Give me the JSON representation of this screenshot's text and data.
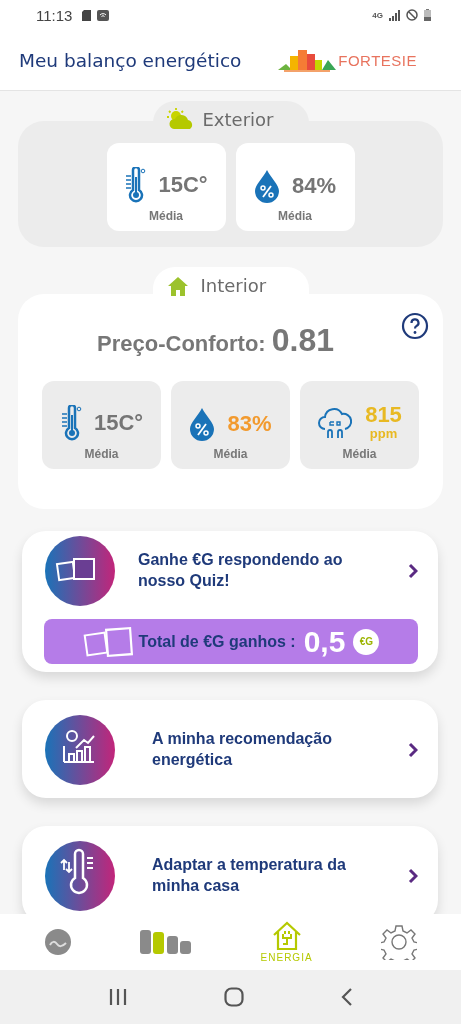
{
  "status_bar": {
    "time": "11:13",
    "network": "4G"
  },
  "header": {
    "title": "Meu balanço energético",
    "logo_text": "FORTESIE"
  },
  "exterior": {
    "title": "Exterior",
    "metrics": [
      {
        "kind": "temperature",
        "value": "15C°",
        "caption": "Média",
        "color": "#757575"
      },
      {
        "kind": "humidity",
        "value": "84%",
        "caption": "Média",
        "color": "#757575"
      }
    ]
  },
  "interior": {
    "title": "Interior",
    "score_label": "Preço-Conforto:",
    "score_value": "0.81",
    "metrics": [
      {
        "kind": "temperature",
        "value": "15C°",
        "caption": "Média",
        "color": "#757575"
      },
      {
        "kind": "humidity",
        "value": "83%",
        "caption": "Média",
        "color": "#f29a2e"
      },
      {
        "kind": "co2",
        "value": "815",
        "unit": "ppm",
        "caption": "Média",
        "color": "#e8b923"
      }
    ]
  },
  "quiz_card": {
    "title": "Ganhe €G respondendo ao nosso Quiz!",
    "total_label": "Total de €G ganhos :",
    "total_value": "0,5",
    "coin": "€G"
  },
  "action_cards": [
    {
      "kind": "recommendation",
      "title": "A minha recomendação energética"
    },
    {
      "kind": "temperature",
      "title": "Adaptar a temperatura da minha casa"
    }
  ],
  "bottom_nav": [
    {
      "kind": "community",
      "selected": false
    },
    {
      "kind": "stats",
      "selected": false
    },
    {
      "kind": "energy",
      "label": "ENERGIA",
      "selected": true
    },
    {
      "kind": "settings",
      "selected": false
    }
  ]
}
